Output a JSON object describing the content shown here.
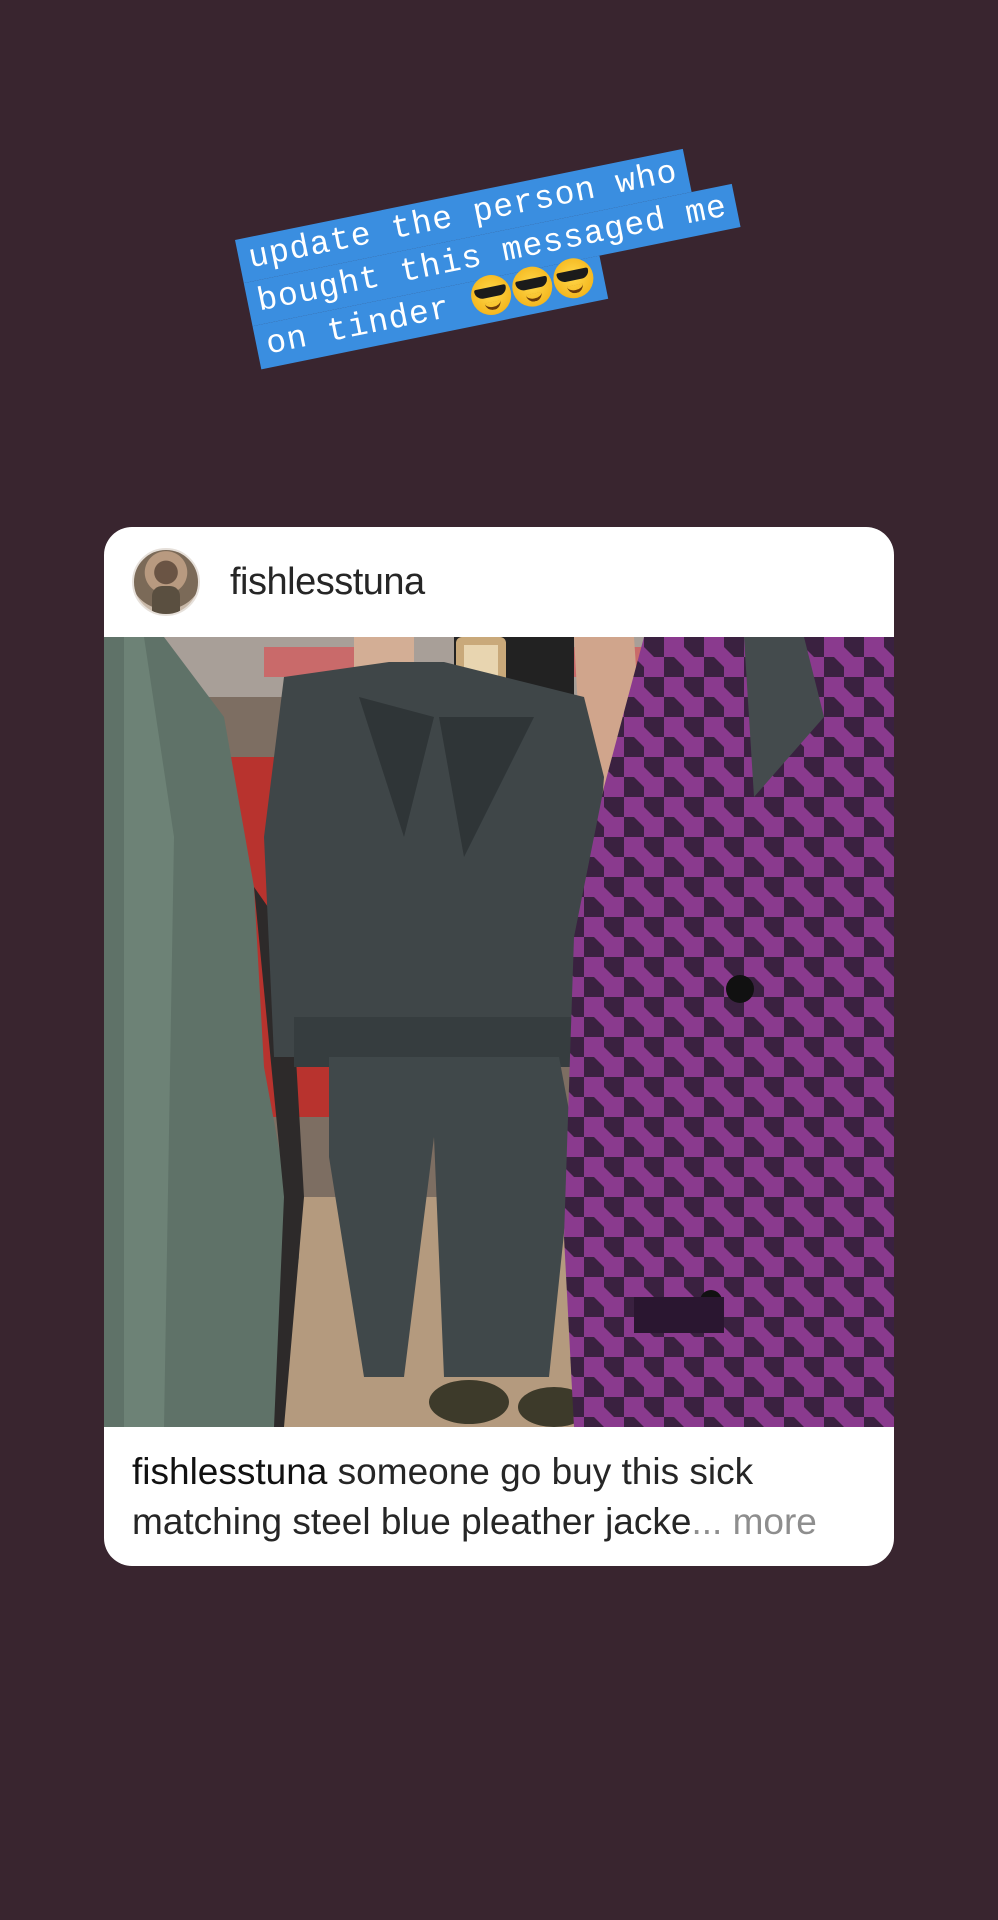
{
  "story": {
    "background_color": "#39252f"
  },
  "sticker": {
    "lines": [
      "update the person who",
      "bought this messaged me",
      "on tinder"
    ],
    "emoji": [
      "sunglasses-face-emoji",
      "sunglasses-face-emoji",
      "sunglasses-face-emoji"
    ],
    "highlight_color": "#3a8ee0"
  },
  "post": {
    "username": "fishlesstuna",
    "caption_user": "fishlesstuna",
    "caption_text": " someone go buy this sick matching steel blue pleather jacke",
    "caption_ellipsis": "...",
    "caption_more": " more"
  }
}
